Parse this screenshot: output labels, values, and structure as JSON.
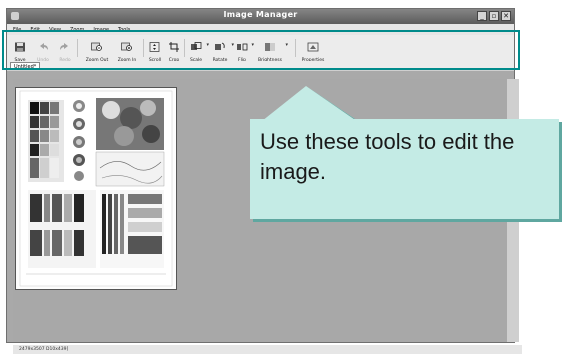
{
  "window": {
    "title": "Image Manager",
    "controls": [
      "_",
      "▫",
      "✕"
    ]
  },
  "menu": {
    "items": [
      "File",
      "Edit",
      "View",
      "Zoom",
      "Image",
      "Tools"
    ]
  },
  "toolbar": {
    "tools": [
      {
        "label": "Save",
        "icon": "floppy-icon",
        "enabled": true
      },
      {
        "label": "Undo",
        "icon": "undo-icon",
        "enabled": false
      },
      {
        "label": "Redo",
        "icon": "redo-icon",
        "enabled": false
      },
      {
        "label": "Zoom Out",
        "icon": "zoom-out-icon",
        "enabled": true
      },
      {
        "label": "Zoom In",
        "icon": "zoom-in-icon",
        "enabled": true
      },
      {
        "label": "Scroll",
        "icon": "scroll-icon",
        "enabled": true
      },
      {
        "label": "Crop",
        "icon": "crop-icon",
        "enabled": true
      },
      {
        "label": "Scale",
        "icon": "scale-icon",
        "enabled": true
      },
      {
        "label": "Rotate",
        "icon": "rotate-icon",
        "enabled": true
      },
      {
        "label": "Flip",
        "icon": "flip-icon",
        "enabled": true
      },
      {
        "label": "Brightness",
        "icon": "brightness-icon",
        "enabled": true
      },
      {
        "label": "Properties",
        "icon": "properties-icon",
        "enabled": true
      }
    ]
  },
  "tabs": [
    {
      "label": "Untitled*"
    }
  ],
  "status": {
    "text": "2479x3507 D10x439]"
  },
  "callout": {
    "text": "Use these tools to edit the image."
  },
  "colors": {
    "callout_bg": "#c4ebe5",
    "highlight_border": "#008b8b",
    "title_bar": "#6a6a6a",
    "canvas": "#a8a8a8"
  }
}
